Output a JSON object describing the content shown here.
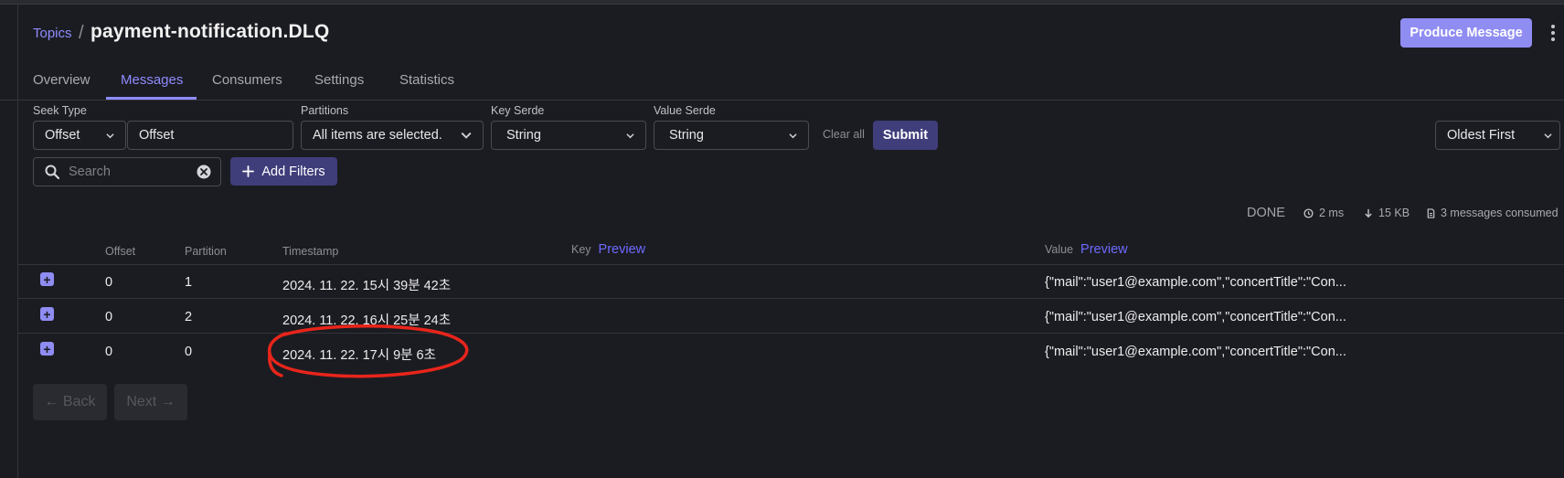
{
  "breadcrumb": {
    "parent": "Topics",
    "separator": "/",
    "title": "payment-notification.DLQ"
  },
  "actions": {
    "produce_label": "Produce Message",
    "more_icon": "more-vertical-icon"
  },
  "tabs": [
    {
      "label": "Overview",
      "active": false
    },
    {
      "label": "Messages",
      "active": true
    },
    {
      "label": "Consumers",
      "active": false
    },
    {
      "label": "Settings",
      "active": false
    },
    {
      "label": "Statistics",
      "active": false
    }
  ],
  "filters": {
    "seek_type": {
      "label": "Seek Type",
      "value": "Offset",
      "input_value": "Offset"
    },
    "partitions": {
      "label": "Partitions",
      "value": "All items are selected."
    },
    "key_serde": {
      "label": "Key Serde",
      "value": "String"
    },
    "value_serde": {
      "label": "Value Serde",
      "value": "String"
    },
    "clear_all": "Clear all",
    "submit": "Submit",
    "sort": "Oldest First",
    "search_placeholder": "Search",
    "add_filters": "Add Filters"
  },
  "status": {
    "state": "DONE",
    "elapsed": "2 ms",
    "size": "15 KB",
    "consumed": "3 messages consumed"
  },
  "table": {
    "headers": {
      "offset": "Offset",
      "partition": "Partition",
      "timestamp": "Timestamp",
      "key": "Key",
      "value": "Value",
      "preview": "Preview"
    },
    "rows": [
      {
        "offset": "0",
        "partition": "1",
        "timestamp": "2024. 11. 22. 15시 39분 42초",
        "key": "",
        "value": "{\"mail\":\"user1@example.com\",\"concertTitle\":\"Con..."
      },
      {
        "offset": "0",
        "partition": "2",
        "timestamp": "2024. 11. 22. 16시 25분 24초",
        "key": "",
        "value": "{\"mail\":\"user1@example.com\",\"concertTitle\":\"Con..."
      },
      {
        "offset": "0",
        "partition": "0",
        "timestamp": "2024. 11. 22. 17시 9분 6초",
        "key": "",
        "value": "{\"mail\":\"user1@example.com\",\"concertTitle\":\"Con..."
      }
    ]
  },
  "pagination": {
    "back": "← Back",
    "next": "Next →"
  },
  "colors": {
    "accent": "#8f8cf2",
    "annotation": "#e8251b",
    "background": "#1b1c21"
  }
}
